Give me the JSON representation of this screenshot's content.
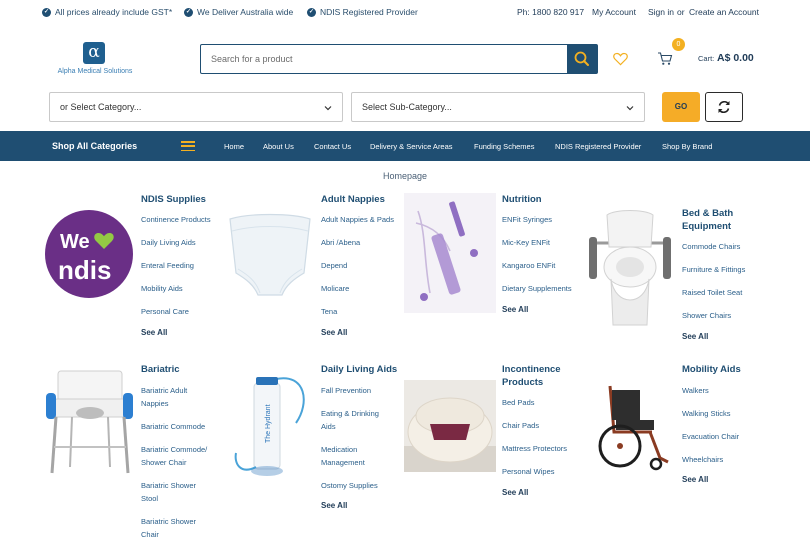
{
  "topbar": {
    "usps": [
      "All prices already include GST*",
      "We Deliver Australia wide",
      "NDIS Registered Provider"
    ],
    "phone": "Ph: 1800 820 917",
    "my_account": "My Account",
    "sign_in": "Sign in",
    "or": "or",
    "create_account": "Create an Account"
  },
  "header": {
    "logo_symbol": "α",
    "logo_text": "Alpha Medical Solutions",
    "search_placeholder": "Search for a product",
    "cart_count": "0",
    "cart_label": "Cart:",
    "cart_total": "A$ 0.00"
  },
  "filters": {
    "category": "or Select Category...",
    "subcategory": "Select Sub-Category...",
    "go": "GO"
  },
  "nav": {
    "all": "Shop All Categories",
    "items": [
      "Home",
      "About Us",
      "Contact Us",
      "Delivery & Service Areas",
      "Funding Schemes",
      "NDIS Registered Provider",
      "Shop By Brand"
    ]
  },
  "breadcrumb": "Homepage",
  "see_all": "See All",
  "categories": [
    {
      "title": [
        "NDIS Supplies"
      ],
      "links": [
        "Continence Products",
        "Daily Living Aids",
        "Enteral Feeding",
        "Mobility Aids",
        "Personal Care"
      ]
    },
    {
      "title": [
        "Adult Nappies"
      ],
      "links": [
        "Adult Nappies & Pads",
        "Abri /Abena",
        "Depend",
        "Molicare",
        "Tena"
      ]
    },
    {
      "title": [
        "Nutrition"
      ],
      "links": [
        "ENFit Syringes",
        "Mic-Key ENFit",
        "Kangaroo ENFit",
        "Dietary Supplements"
      ]
    },
    {
      "title": [
        "Bed & Bath",
        "Equipment"
      ],
      "links": [
        "Commode Chairs",
        "Furniture & Fittings",
        "Raised Toilet Seat",
        "Shower Chairs"
      ]
    },
    {
      "title": [
        "Bariatric"
      ],
      "links": [
        [
          "Bariatric Adult",
          "Nappies"
        ],
        [
          "Bariatric Commode"
        ],
        [
          "Bariatric Commode/",
          "Shower Chair"
        ],
        [
          "Bariatric Shower",
          "Stool"
        ],
        [
          "Bariatric Shower",
          "Chair"
        ]
      ]
    },
    {
      "title": [
        "Daily Living Aids"
      ],
      "links": [
        [
          "Fall Prevention"
        ],
        [
          "Eating & Drinking",
          "Aids"
        ],
        [
          "Medication",
          "Management"
        ],
        [
          "Ostomy Supplies"
        ]
      ]
    },
    {
      "title": [
        "Incontinence",
        "Products"
      ],
      "links": [
        "Bed Pads",
        "Chair Pads",
        "Mattress Protectors",
        "Personal Wipes"
      ]
    },
    {
      "title": [
        "Mobility Aids"
      ],
      "links": [
        "Walkers",
        "Walking Sticks",
        "Evacuation Chair",
        "Wheelchairs"
      ]
    }
  ],
  "ndis_logo": {
    "line1": "We",
    "line2": "ndis"
  },
  "colors": {
    "primary": "#1f4e72",
    "accent": "#f5ac27",
    "ndis_purple": "#6a2f86",
    "ndis_green": "#93c944"
  }
}
